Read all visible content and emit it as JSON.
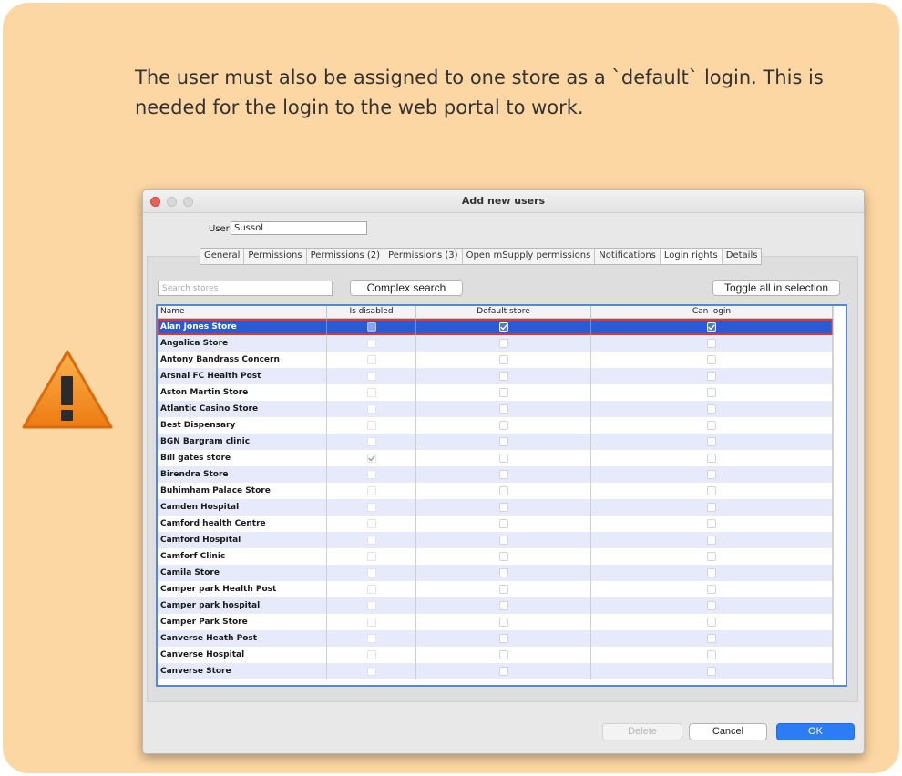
{
  "note": {
    "text": "The user must also be assigned to one store as a `default` login. This is needed for the login to the web portal to work.",
    "background_color": "#fdd7a3",
    "icon": "warning-triangle-icon"
  },
  "window": {
    "title": "Add new users",
    "user_label": "User",
    "user_value": "Sussol",
    "tabs": [
      {
        "label": "General",
        "active": false
      },
      {
        "label": "Permissions",
        "active": false
      },
      {
        "label": "Permissions (2)",
        "active": false
      },
      {
        "label": "Permissions (3)",
        "active": false
      },
      {
        "label": "Open mSupply permissions",
        "active": false
      },
      {
        "label": "Notifications",
        "active": false
      },
      {
        "label": "Login rights",
        "active": true
      },
      {
        "label": "Details",
        "active": false
      }
    ],
    "search_placeholder": "Search stores",
    "complex_search_label": "Complex search",
    "toggle_all_label": "Toggle all in selection",
    "columns": [
      "Name",
      "Is disabled",
      "Default store",
      "Can login"
    ],
    "rows": [
      {
        "name": "Alan Jones Store",
        "is_disabled": false,
        "default_store": true,
        "can_login": true,
        "selected": true
      },
      {
        "name": "Angalica Store",
        "is_disabled": false,
        "default_store": false,
        "can_login": false
      },
      {
        "name": "Antony Bandrass Concern",
        "is_disabled": false,
        "default_store": false,
        "can_login": false
      },
      {
        "name": "Arsnal FC Health Post",
        "is_disabled": false,
        "default_store": false,
        "can_login": false
      },
      {
        "name": "Aston Martin Store",
        "is_disabled": false,
        "default_store": false,
        "can_login": false
      },
      {
        "name": "Atlantic Casino Store",
        "is_disabled": false,
        "default_store": false,
        "can_login": false
      },
      {
        "name": "Best Dispensary",
        "is_disabled": false,
        "default_store": false,
        "can_login": false
      },
      {
        "name": "BGN Bargram clinic",
        "is_disabled": false,
        "default_store": false,
        "can_login": false
      },
      {
        "name": "Bill gates store",
        "is_disabled": true,
        "default_store": false,
        "can_login": false
      },
      {
        "name": "Birendra Store",
        "is_disabled": false,
        "default_store": false,
        "can_login": false
      },
      {
        "name": "Buhimham Palace Store",
        "is_disabled": false,
        "default_store": false,
        "can_login": false
      },
      {
        "name": "Camden Hospital",
        "is_disabled": false,
        "default_store": false,
        "can_login": false
      },
      {
        "name": "Camford health Centre",
        "is_disabled": false,
        "default_store": false,
        "can_login": false
      },
      {
        "name": "Camford Hospital",
        "is_disabled": false,
        "default_store": false,
        "can_login": false
      },
      {
        "name": "Camforf Clinic",
        "is_disabled": false,
        "default_store": false,
        "can_login": false
      },
      {
        "name": "Camila Store",
        "is_disabled": false,
        "default_store": false,
        "can_login": false
      },
      {
        "name": "Camper park Health Post",
        "is_disabled": false,
        "default_store": false,
        "can_login": false
      },
      {
        "name": "Camper park hospital",
        "is_disabled": false,
        "default_store": false,
        "can_login": false
      },
      {
        "name": "Camper Park Store",
        "is_disabled": false,
        "default_store": false,
        "can_login": false
      },
      {
        "name": "Canverse Heath Post",
        "is_disabled": false,
        "default_store": false,
        "can_login": false
      },
      {
        "name": "Canverse Hospital",
        "is_disabled": false,
        "default_store": false,
        "can_login": false
      },
      {
        "name": "Canverse Store",
        "is_disabled": false,
        "default_store": false,
        "can_login": false
      }
    ],
    "buttons": {
      "delete": "Delete",
      "cancel": "Cancel",
      "ok": "OK"
    }
  }
}
